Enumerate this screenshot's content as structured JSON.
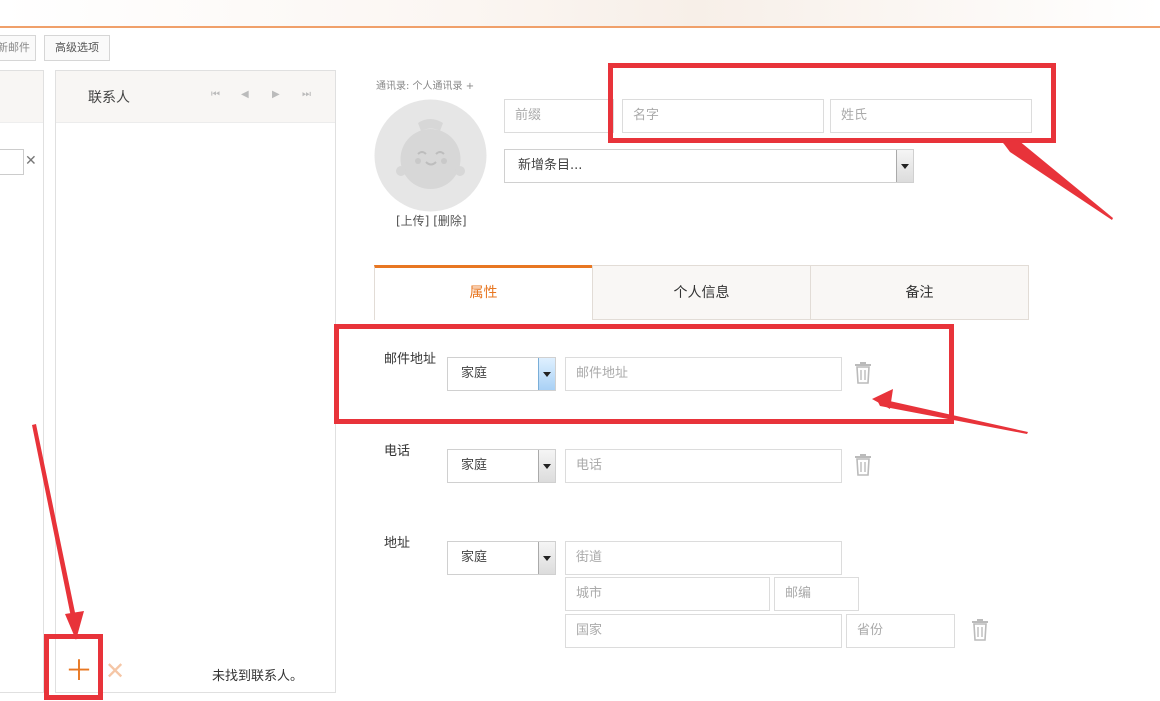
{
  "toolbar": {
    "partial_button": "新邮件",
    "advanced_button": "高级选项"
  },
  "contacts_panel": {
    "title": "联系人",
    "nav_first": "⏮",
    "nav_prev": "◀",
    "nav_next": "▶",
    "nav_last": "⏭",
    "empty_text": "未找到联系人。",
    "add_icon": "＋",
    "delete_icon": "✕"
  },
  "left_panel": {
    "clear_icon": "✕"
  },
  "contact_form": {
    "addressbook_label": "通讯录: 个人通讯录 +",
    "photo_upload": "[上传]",
    "photo_delete": "[删除]",
    "prefix_placeholder": "前缀",
    "firstname_placeholder": "名字",
    "lastname_placeholder": "姓氏",
    "add_field_select": "新增条目...",
    "tabs": [
      {
        "label": "属性",
        "active": true
      },
      {
        "label": "个人信息",
        "active": false
      },
      {
        "label": "备注",
        "active": false
      }
    ],
    "email": {
      "label": "邮件地址",
      "type": "家庭",
      "placeholder": "邮件地址"
    },
    "phone": {
      "label": "电话",
      "type": "家庭",
      "placeholder": "电话"
    },
    "address": {
      "label": "地址",
      "type": "家庭",
      "street_placeholder": "街道",
      "city_placeholder": "城市",
      "zip_placeholder": "邮编",
      "country_placeholder": "国家",
      "province_placeholder": "省份"
    }
  },
  "colors": {
    "accent": "#e87722",
    "annotation_red": "#e8333a"
  }
}
